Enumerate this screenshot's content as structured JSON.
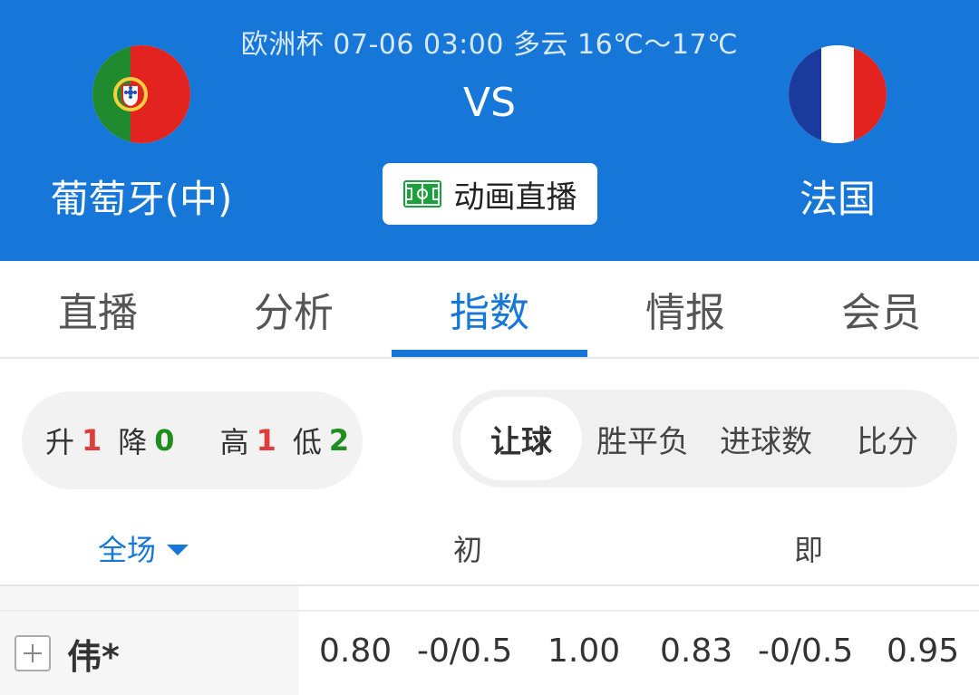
{
  "match": {
    "info": "欧洲杯 07-06 03:00 多云 16℃～17℃",
    "vs": "VS",
    "home_team": "葡萄牙(中)",
    "away_team": "法国",
    "live_button": "动画直播",
    "header_color": "#1677d9"
  },
  "tabs": [
    {
      "label": "直播",
      "active": false
    },
    {
      "label": "分析",
      "active": false
    },
    {
      "label": "指数",
      "active": true
    },
    {
      "label": "情报",
      "active": false
    },
    {
      "label": "会员",
      "active": false
    }
  ],
  "stats": {
    "up_label": "升",
    "up_value": "1",
    "down_label": "降",
    "down_value": "0",
    "high_label": "高",
    "high_value": "1",
    "low_label": "低",
    "low_value": "2"
  },
  "odds_types": [
    {
      "label": "让球",
      "selected": true
    },
    {
      "label": "胜平负",
      "selected": false
    },
    {
      "label": "进球数",
      "selected": false
    },
    {
      "label": "比分",
      "selected": false
    }
  ],
  "columns": {
    "scope": "全场",
    "initial": "初",
    "instant": "即"
  },
  "rows": [
    {
      "company": "伟*",
      "initial": {
        "home": "0.80",
        "handicap": "-0/0.5",
        "away": "1.00"
      },
      "instant": {
        "home": "0.83",
        "handicap": "-0/0.5",
        "away": "0.95"
      }
    }
  ],
  "colors": {
    "accent": "#1677d9",
    "rise": "#e03c3c",
    "fall": "#1e8e1e"
  }
}
